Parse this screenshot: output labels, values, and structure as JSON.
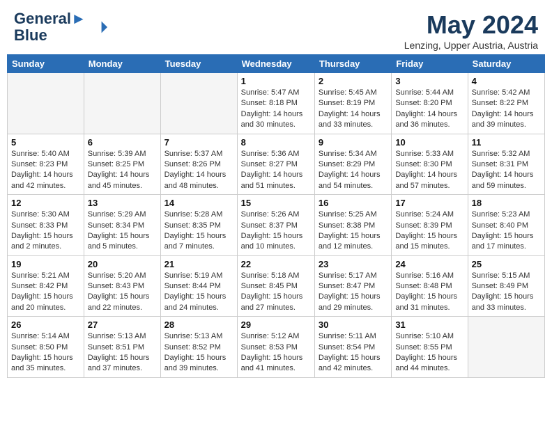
{
  "header": {
    "logo_line1": "General",
    "logo_line2": "Blue",
    "month": "May 2024",
    "location": "Lenzing, Upper Austria, Austria"
  },
  "days_of_week": [
    "Sunday",
    "Monday",
    "Tuesday",
    "Wednesday",
    "Thursday",
    "Friday",
    "Saturday"
  ],
  "weeks": [
    [
      {
        "day": "",
        "info": ""
      },
      {
        "day": "",
        "info": ""
      },
      {
        "day": "",
        "info": ""
      },
      {
        "day": "1",
        "info": "Sunrise: 5:47 AM\nSunset: 8:18 PM\nDaylight: 14 hours and 30 minutes."
      },
      {
        "day": "2",
        "info": "Sunrise: 5:45 AM\nSunset: 8:19 PM\nDaylight: 14 hours and 33 minutes."
      },
      {
        "day": "3",
        "info": "Sunrise: 5:44 AM\nSunset: 8:20 PM\nDaylight: 14 hours and 36 minutes."
      },
      {
        "day": "4",
        "info": "Sunrise: 5:42 AM\nSunset: 8:22 PM\nDaylight: 14 hours and 39 minutes."
      }
    ],
    [
      {
        "day": "5",
        "info": "Sunrise: 5:40 AM\nSunset: 8:23 PM\nDaylight: 14 hours and 42 minutes."
      },
      {
        "day": "6",
        "info": "Sunrise: 5:39 AM\nSunset: 8:25 PM\nDaylight: 14 hours and 45 minutes."
      },
      {
        "day": "7",
        "info": "Sunrise: 5:37 AM\nSunset: 8:26 PM\nDaylight: 14 hours and 48 minutes."
      },
      {
        "day": "8",
        "info": "Sunrise: 5:36 AM\nSunset: 8:27 PM\nDaylight: 14 hours and 51 minutes."
      },
      {
        "day": "9",
        "info": "Sunrise: 5:34 AM\nSunset: 8:29 PM\nDaylight: 14 hours and 54 minutes."
      },
      {
        "day": "10",
        "info": "Sunrise: 5:33 AM\nSunset: 8:30 PM\nDaylight: 14 hours and 57 minutes."
      },
      {
        "day": "11",
        "info": "Sunrise: 5:32 AM\nSunset: 8:31 PM\nDaylight: 14 hours and 59 minutes."
      }
    ],
    [
      {
        "day": "12",
        "info": "Sunrise: 5:30 AM\nSunset: 8:33 PM\nDaylight: 15 hours and 2 minutes."
      },
      {
        "day": "13",
        "info": "Sunrise: 5:29 AM\nSunset: 8:34 PM\nDaylight: 15 hours and 5 minutes."
      },
      {
        "day": "14",
        "info": "Sunrise: 5:28 AM\nSunset: 8:35 PM\nDaylight: 15 hours and 7 minutes."
      },
      {
        "day": "15",
        "info": "Sunrise: 5:26 AM\nSunset: 8:37 PM\nDaylight: 15 hours and 10 minutes."
      },
      {
        "day": "16",
        "info": "Sunrise: 5:25 AM\nSunset: 8:38 PM\nDaylight: 15 hours and 12 minutes."
      },
      {
        "day": "17",
        "info": "Sunrise: 5:24 AM\nSunset: 8:39 PM\nDaylight: 15 hours and 15 minutes."
      },
      {
        "day": "18",
        "info": "Sunrise: 5:23 AM\nSunset: 8:40 PM\nDaylight: 15 hours and 17 minutes."
      }
    ],
    [
      {
        "day": "19",
        "info": "Sunrise: 5:21 AM\nSunset: 8:42 PM\nDaylight: 15 hours and 20 minutes."
      },
      {
        "day": "20",
        "info": "Sunrise: 5:20 AM\nSunset: 8:43 PM\nDaylight: 15 hours and 22 minutes."
      },
      {
        "day": "21",
        "info": "Sunrise: 5:19 AM\nSunset: 8:44 PM\nDaylight: 15 hours and 24 minutes."
      },
      {
        "day": "22",
        "info": "Sunrise: 5:18 AM\nSunset: 8:45 PM\nDaylight: 15 hours and 27 minutes."
      },
      {
        "day": "23",
        "info": "Sunrise: 5:17 AM\nSunset: 8:47 PM\nDaylight: 15 hours and 29 minutes."
      },
      {
        "day": "24",
        "info": "Sunrise: 5:16 AM\nSunset: 8:48 PM\nDaylight: 15 hours and 31 minutes."
      },
      {
        "day": "25",
        "info": "Sunrise: 5:15 AM\nSunset: 8:49 PM\nDaylight: 15 hours and 33 minutes."
      }
    ],
    [
      {
        "day": "26",
        "info": "Sunrise: 5:14 AM\nSunset: 8:50 PM\nDaylight: 15 hours and 35 minutes."
      },
      {
        "day": "27",
        "info": "Sunrise: 5:13 AM\nSunset: 8:51 PM\nDaylight: 15 hours and 37 minutes."
      },
      {
        "day": "28",
        "info": "Sunrise: 5:13 AM\nSunset: 8:52 PM\nDaylight: 15 hours and 39 minutes."
      },
      {
        "day": "29",
        "info": "Sunrise: 5:12 AM\nSunset: 8:53 PM\nDaylight: 15 hours and 41 minutes."
      },
      {
        "day": "30",
        "info": "Sunrise: 5:11 AM\nSunset: 8:54 PM\nDaylight: 15 hours and 42 minutes."
      },
      {
        "day": "31",
        "info": "Sunrise: 5:10 AM\nSunset: 8:55 PM\nDaylight: 15 hours and 44 minutes."
      },
      {
        "day": "",
        "info": ""
      }
    ]
  ]
}
